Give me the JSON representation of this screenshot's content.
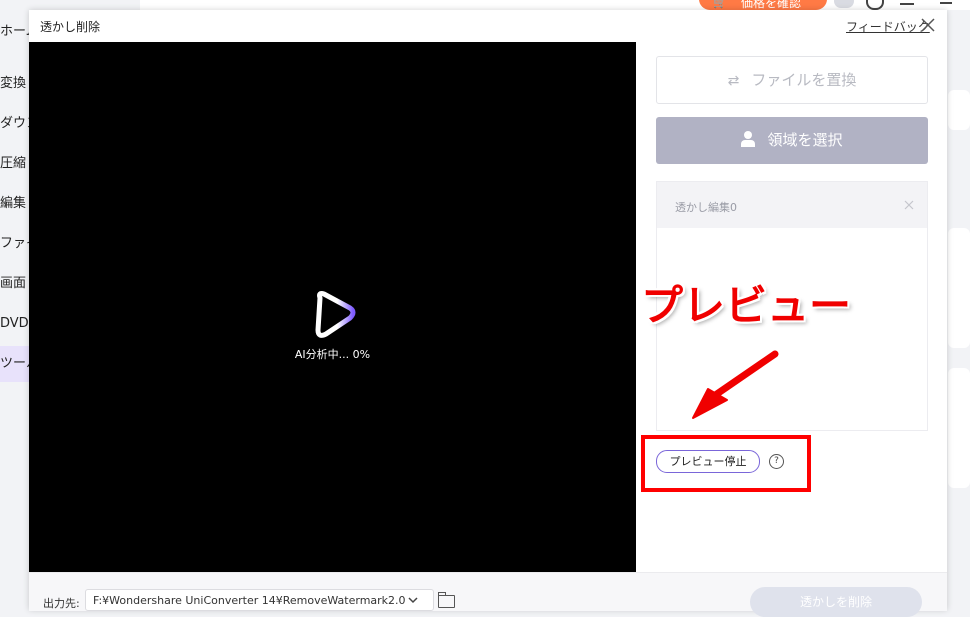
{
  "app": {
    "price_button": "価格を確認",
    "cart_icon": "cart-icon",
    "sidebar": [
      {
        "label": "ホーム",
        "active": false
      },
      {
        "label": "変換",
        "active": false
      },
      {
        "label": "ダウン",
        "active": false
      },
      {
        "label": "圧縮",
        "active": false
      },
      {
        "label": "編集",
        "active": false
      },
      {
        "label": "ファイ",
        "active": false
      },
      {
        "label": "画面",
        "active": false
      },
      {
        "label": "DVD",
        "active": false
      },
      {
        "label": "ツール",
        "active": true
      }
    ]
  },
  "dialog": {
    "title": "透かし削除",
    "feedback": "フィードバック",
    "analyzing": "AI分析中... 0%",
    "replace_file": "ファイルを置換",
    "select_region": "領域を選択",
    "edit_title": "透かし編集0",
    "preview_stop": "プレビュー停止",
    "help": "?",
    "output_label": "出力先:",
    "output_path": "F:¥Wondershare UniConverter 14¥RemoveWatermark2.0",
    "remove_button": "透かしを削除"
  },
  "annotation": {
    "text": "プレビュー",
    "color": "#ff0000"
  },
  "colors": {
    "accent_purple": "#7a66d9",
    "region_button": "#b1b2c4",
    "price_orange": "#ff7a45"
  }
}
